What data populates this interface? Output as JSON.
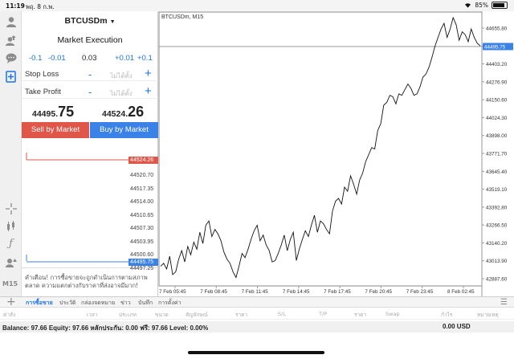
{
  "status": {
    "time": "11:19",
    "date": "พฤ. 8 ก.พ.",
    "battery": "85%",
    "battery_level": 0.85
  },
  "left_toolbar": {
    "icons": [
      "user-icon",
      "upload-user-icon",
      "chat-icon",
      "new-order-icon",
      "crosshair-icon",
      "indicators-icon",
      "function-icon",
      "objects-icon"
    ],
    "timeframe": "M15"
  },
  "order": {
    "symbol": "BTCUSDm",
    "execution": "Market Execution",
    "lot_minus_01": "-0.1",
    "lot_minus_001": "-0.01",
    "lot_value": "0.03",
    "lot_plus_001": "+0.01",
    "lot_plus_01": "+0.1",
    "stop_loss_label": "Stop Loss",
    "stop_loss_value": "ไม่ได้ตั้ง",
    "take_profit_label": "Take Profit",
    "take_profit_value": "ไม่ได้ตั้ง",
    "minus": "-",
    "plus": "+",
    "sell_price_prefix": "44495.",
    "sell_price_big": "75",
    "buy_price_prefix": "44524.",
    "buy_price_big": "26",
    "sell_button": "Sell by Market",
    "buy_button": "Buy by Market",
    "tick_ask": "44524.26",
    "tick_bid": "44495.75",
    "tick_levels": [
      "44520.70",
      "44517.35",
      "44514.00",
      "44510.65",
      "44507.30",
      "44503.95",
      "44500.60",
      "44497.25"
    ],
    "warning": "คำเตือน! การซื้อขายจะถูกดำเนินการตามสภาพตลาด ความแตกต่างกับราคาที่ส่งอาจมีมาก!"
  },
  "chart_data": {
    "type": "line",
    "title": "BTCUSDm, M15",
    "y_ticks": [
      "44655.80",
      "44529.50",
      "44403.20",
      "44276.90",
      "44150.60",
      "44024.30",
      "43898.00",
      "43771.70",
      "43645.40",
      "43519.10",
      "43392.80",
      "43266.50",
      "43140.20",
      "43013.90",
      "42887.60"
    ],
    "x_ticks": [
      "7 Feb 05:45",
      "7 Feb 08:45",
      "7 Feb 11:45",
      "7 Feb 14:45",
      "7 Feb 17:45",
      "7 Feb 20:45",
      "7 Feb 23:45",
      "8 Feb 02:45"
    ],
    "current_price": "44495.75",
    "current_price_value": 44495.75,
    "ylim": [
      42800,
      44740
    ],
    "series": [
      {
        "values": [
          42940,
          42960,
          42920,
          43010,
          42880,
          42900,
          42990,
          43050,
          42970,
          43080,
          43020,
          43110,
          43060,
          43180,
          43100,
          43230,
          43260,
          43150,
          43200,
          43170,
          43120,
          43040,
          42990,
          42960,
          42900,
          42860,
          42940,
          43030,
          43000,
          43060,
          43130,
          43190,
          43230,
          43120,
          43160,
          43090,
          43050,
          42970,
          42980,
          43030,
          43090,
          43160,
          43050,
          43130,
          43180,
          42980,
          43060,
          43130,
          43190,
          43150,
          43230,
          43300,
          43180,
          43260,
          43240,
          43200,
          43170,
          43330,
          43400,
          43420,
          43380,
          43500,
          43470,
          43580,
          43520,
          43450,
          43550,
          43600,
          43680,
          43730,
          43780,
          43770,
          43900,
          43950,
          44080,
          44100,
          44150,
          44140,
          44090,
          44160,
          44150,
          44190,
          44230,
          44200,
          44150,
          44160,
          44210,
          44280,
          44300,
          44350,
          44420,
          44500,
          44560,
          44620,
          44660,
          44560,
          44620,
          44700,
          44650,
          44540,
          44600,
          44580,
          44530,
          44620,
          44560,
          44520,
          44500
        ]
      }
    ]
  },
  "bottom": {
    "plus": "+",
    "tabs": [
      "การซื้อขาย",
      "ประวัติ",
      "กล่องจดหมาย",
      "ข่าว",
      "บันทึก",
      "การตั้งค่า"
    ],
    "columns": [
      "ค่าสั่ง",
      "เวลา",
      "ประเภท",
      "ขนาด",
      "สัญลักษณ์",
      "ราคา",
      "S/L",
      "T/P",
      "ราคา",
      "Swap",
      "กำไร",
      "หมายเหตุ"
    ],
    "balance_text": "Balance: 97.66 Equity: 97.66 หลักประกัน: 0.00 ฟรี: 97.66 Level: 0.00%",
    "total": "0.00  USD"
  }
}
